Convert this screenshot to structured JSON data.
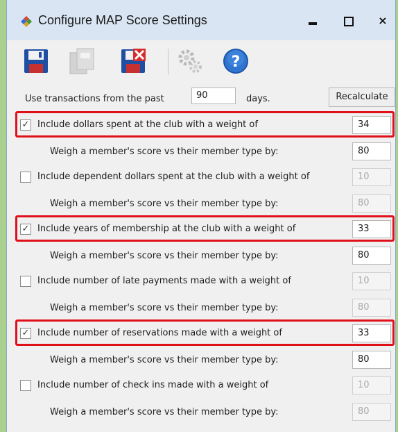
{
  "window": {
    "title": "Configure MAP Score Settings",
    "minimize_label": "",
    "maximize_label": "",
    "close_label": "×"
  },
  "toolbar": {
    "buttons": [
      {
        "icon": "save-icon"
      },
      {
        "icon": "copy-icon"
      },
      {
        "icon": "delete-icon"
      },
      {
        "icon": "settings-icon"
      },
      {
        "icon": "help-icon"
      }
    ]
  },
  "transactions": {
    "prefix": "Use transactions from the past",
    "days_value": "90",
    "suffix": "days.",
    "recalculate_label": "Recalculate"
  },
  "criteria": [
    {
      "checked": true,
      "label": "Include dollars spent at the club with a weight of",
      "weight": "34",
      "enabled": true,
      "highlighted": true,
      "sub_label": "Weigh a member's score vs their member type by:",
      "sub_value": "80"
    },
    {
      "checked": false,
      "label": "Include dependent dollars spent at the club with a weight of",
      "weight": "10",
      "enabled": false,
      "highlighted": false,
      "sub_label": "Weigh a member's score vs their member type by:",
      "sub_value": "80"
    },
    {
      "checked": true,
      "label": "Include years of membership at the club with a weight of",
      "weight": "33",
      "enabled": true,
      "highlighted": true,
      "sub_label": "Weigh a member's score vs their member type by:",
      "sub_value": "80"
    },
    {
      "checked": false,
      "label": "Include number of late payments made with a weight of",
      "weight": "10",
      "enabled": false,
      "highlighted": false,
      "sub_label": "Weigh a member's score vs their member type by:",
      "sub_value": "80"
    },
    {
      "checked": true,
      "label": "Include number of reservations made with a weight of",
      "weight": "33",
      "enabled": true,
      "highlighted": true,
      "sub_label": "Weigh a member's score vs their member type by:",
      "sub_value": "80"
    },
    {
      "checked": false,
      "label": "Include number of check ins made with a weight of",
      "weight": "10",
      "enabled": false,
      "highlighted": false,
      "sub_label": "Weigh a member's score vs their member type by:",
      "sub_value": "80"
    }
  ],
  "colors": {
    "highlight": "#e0101a",
    "background": "#a9d08e",
    "titlebar": "#d9e5f3"
  }
}
